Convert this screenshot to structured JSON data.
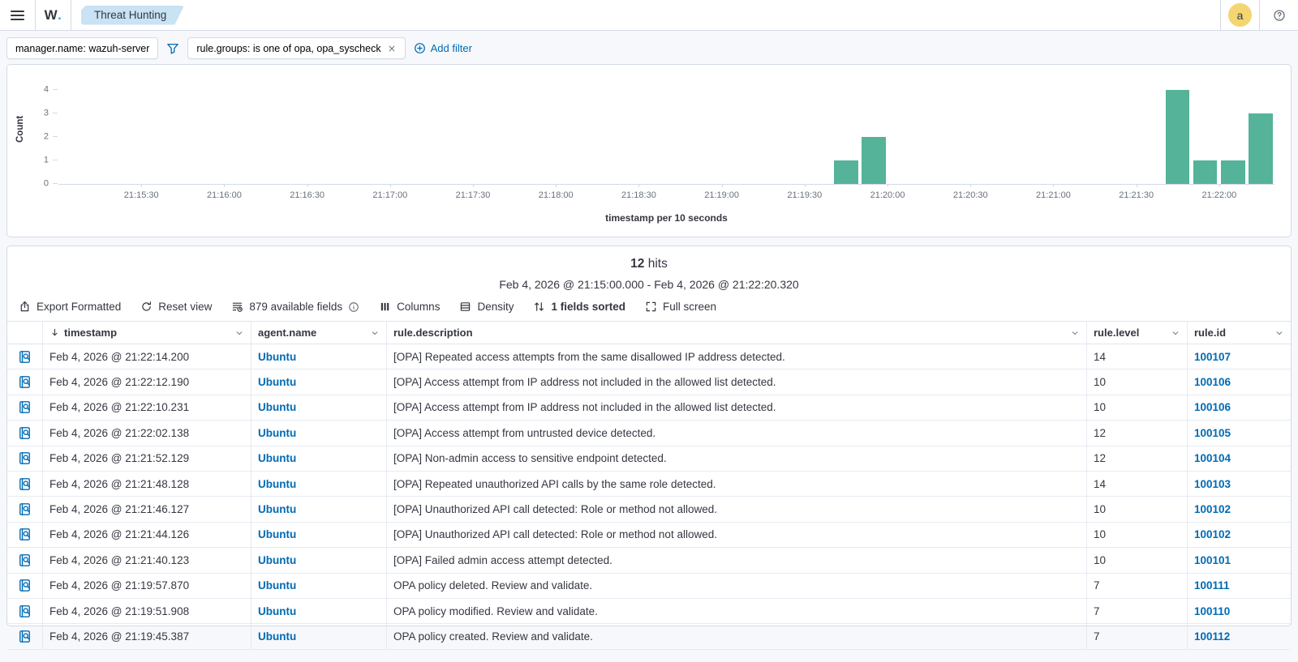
{
  "navbar": {
    "logo_w": "W",
    "logo_dot": ".",
    "breadcrumb": "Threat Hunting",
    "avatar_initial": "a"
  },
  "filters": {
    "pinned_filter": "manager.name: wazuh-server",
    "active_filter": "rule.groups: is one of opa, opa_syscheck",
    "add_filter_label": "Add filter"
  },
  "chart_data": {
    "type": "bar",
    "title": "",
    "xlabel": "timestamp per 10 seconds",
    "ylabel": "Count",
    "x_start": "21:15:00",
    "x_end": "21:22:20",
    "bucket_seconds": 10,
    "bar_color": "#54B399",
    "ylim": [
      0,
      4
    ],
    "y_ticks": [
      0,
      1,
      2,
      3,
      4
    ],
    "x_ticks": [
      "21:15:30",
      "21:16:00",
      "21:16:30",
      "21:17:00",
      "21:17:30",
      "21:18:00",
      "21:18:30",
      "21:19:00",
      "21:19:30",
      "21:20:00",
      "21:20:30",
      "21:21:00",
      "21:21:30",
      "21:22:00"
    ],
    "buckets": [
      {
        "time": "21:19:40",
        "count": 1
      },
      {
        "time": "21:19:50",
        "count": 2
      },
      {
        "time": "21:21:40",
        "count": 4
      },
      {
        "time": "21:21:50",
        "count": 1
      },
      {
        "time": "21:22:00",
        "count": 1
      },
      {
        "time": "21:22:10",
        "count": 3
      }
    ]
  },
  "results": {
    "hits_count": "12",
    "hits_label": "hits",
    "time_range": "Feb 4, 2026 @ 21:15:00.000 - Feb 4, 2026 @ 21:22:20.320",
    "toolbar": [
      {
        "icon": "export-icon",
        "label": "Export Formatted"
      },
      {
        "icon": "refresh-icon",
        "label": "Reset view"
      },
      {
        "icon": "fields-icon",
        "label": "879 available fields",
        "suffix_icon": "info-icon"
      },
      {
        "icon": "columns-icon",
        "label": "Columns"
      },
      {
        "icon": "density-icon",
        "label": "Density"
      },
      {
        "icon": "sort-icon",
        "label": "1 fields sorted",
        "bold": true
      },
      {
        "icon": "fullscreen-icon",
        "label": "Full screen"
      }
    ]
  },
  "table": {
    "columns": [
      {
        "field": "timestamp",
        "label": "timestamp",
        "sorted": "desc"
      },
      {
        "field": "agent",
        "label": "agent.name"
      },
      {
        "field": "description",
        "label": "rule.description"
      },
      {
        "field": "level",
        "label": "rule.level"
      },
      {
        "field": "id",
        "label": "rule.id"
      }
    ],
    "rows": [
      {
        "timestamp": "Feb 4, 2026 @ 21:22:14.200",
        "agent": "Ubuntu",
        "description": "[OPA] Repeated access attempts from the same disallowed IP address detected.",
        "level": "14",
        "id": "100107"
      },
      {
        "timestamp": "Feb 4, 2026 @ 21:22:12.190",
        "agent": "Ubuntu",
        "description": "[OPA] Access attempt from IP address not included in the allowed list detected.",
        "level": "10",
        "id": "100106"
      },
      {
        "timestamp": "Feb 4, 2026 @ 21:22:10.231",
        "agent": "Ubuntu",
        "description": "[OPA] Access attempt from IP address not included in the allowed list detected.",
        "level": "10",
        "id": "100106"
      },
      {
        "timestamp": "Feb 4, 2026 @ 21:22:02.138",
        "agent": "Ubuntu",
        "description": "[OPA] Access attempt from untrusted device detected.",
        "level": "12",
        "id": "100105"
      },
      {
        "timestamp": "Feb 4, 2026 @ 21:21:52.129",
        "agent": "Ubuntu",
        "description": "[OPA] Non-admin access to sensitive endpoint detected.",
        "level": "12",
        "id": "100104"
      },
      {
        "timestamp": "Feb 4, 2026 @ 21:21:48.128",
        "agent": "Ubuntu",
        "description": "[OPA] Repeated unauthorized API calls by the same role detected.",
        "level": "14",
        "id": "100103"
      },
      {
        "timestamp": "Feb 4, 2026 @ 21:21:46.127",
        "agent": "Ubuntu",
        "description": "[OPA] Unauthorized API call detected: Role or method not allowed.",
        "level": "10",
        "id": "100102"
      },
      {
        "timestamp": "Feb 4, 2026 @ 21:21:44.126",
        "agent": "Ubuntu",
        "description": "[OPA] Unauthorized API call detected: Role or method not allowed.",
        "level": "10",
        "id": "100102"
      },
      {
        "timestamp": "Feb 4, 2026 @ 21:21:40.123",
        "agent": "Ubuntu",
        "description": "[OPA] Failed admin access attempt detected.",
        "level": "10",
        "id": "100101"
      },
      {
        "timestamp": "Feb 4, 2026 @ 21:19:57.870",
        "agent": "Ubuntu",
        "description": "OPA policy deleted. Review and validate.",
        "level": "7",
        "id": "100111"
      },
      {
        "timestamp": "Feb 4, 2026 @ 21:19:51.908",
        "agent": "Ubuntu",
        "description": "OPA policy modified. Review and validate.",
        "level": "7",
        "id": "100110"
      },
      {
        "timestamp": "Feb 4, 2026 @ 21:19:45.387",
        "agent": "Ubuntu",
        "description": "OPA policy created. Review and validate.",
        "level": "7",
        "id": "100112"
      }
    ]
  }
}
